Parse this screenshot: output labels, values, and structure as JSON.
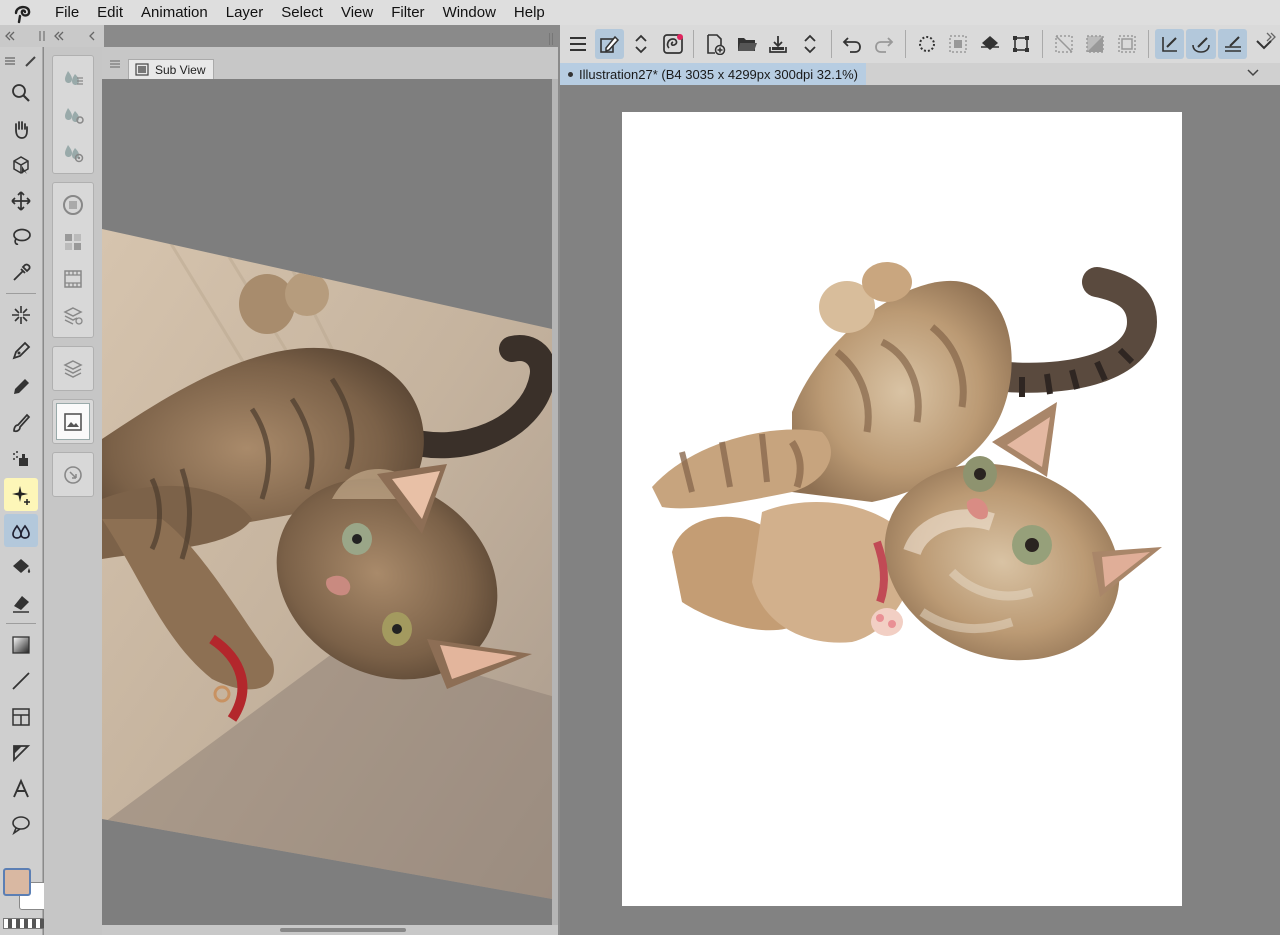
{
  "menu": [
    "File",
    "Edit",
    "Animation",
    "Layer",
    "Select",
    "View",
    "Filter",
    "Window",
    "Help"
  ],
  "icons": {
    "app_logo": "app-logo-icon",
    "tools": [
      "zoom-icon",
      "hand-icon",
      "object-select-icon",
      "move-icon",
      "lasso-icon",
      "eyedropper-icon",
      "auto-select-icon",
      "pen-icon",
      "pencil-icon",
      "brush-icon",
      "airbrush-icon",
      "decoration-icon",
      "blend-icon",
      "fill-icon",
      "eraser-icon",
      "gradient-icon",
      "figure-icon",
      "frame-icon",
      "ruler-icon",
      "text-icon",
      "balloon-icon"
    ]
  },
  "colors": {
    "main_color": "#d9b8a2",
    "sub_color": "#ffffff",
    "selected_tool": "#b3c8db",
    "highlight_tool": "#fdf6b8"
  },
  "subview": {
    "tab_label": "Sub View"
  },
  "document": {
    "tab_label": "Illustration27* (B4 3035 x 4299px 300dpi 32.1%)"
  }
}
